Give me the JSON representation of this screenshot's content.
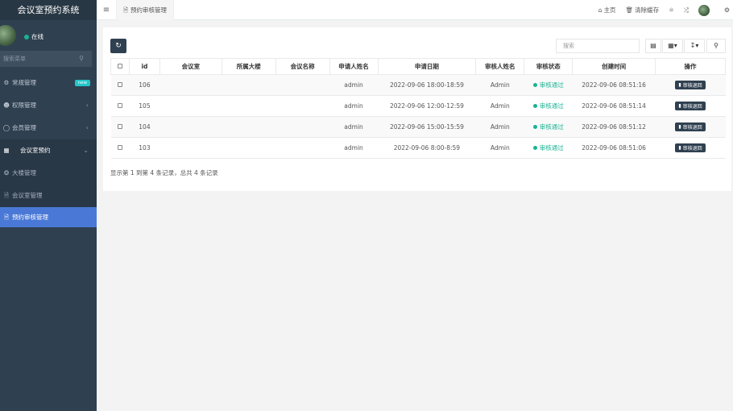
{
  "app": {
    "title": "会议室预约系统"
  },
  "user": {
    "status": "在线"
  },
  "sidebar": {
    "search_placeholder": "搜索菜单",
    "items": [
      {
        "label": "常规管理",
        "icon": "cogs-icon",
        "badge": "new"
      },
      {
        "label": "权限管理",
        "icon": "users-icon"
      },
      {
        "label": "会员管理",
        "icon": "user-icon"
      },
      {
        "label": "会议室预约",
        "icon": "list-icon",
        "open": true
      }
    ],
    "subitems": [
      {
        "label": "大楼管理",
        "icon": "circle-icon"
      },
      {
        "label": "会议室管理",
        "icon": "file-icon"
      },
      {
        "label": "预约审核管理",
        "icon": "file-icon",
        "active": true
      }
    ]
  },
  "topbar": {
    "tab_label": "预约审核管理",
    "home": "主页",
    "clear_cache": "清除缓存"
  },
  "toolbar": {
    "search_placeholder": "搜索"
  },
  "table": {
    "headers": [
      "id",
      "会议室",
      "所属大楼",
      "会议名称",
      "申请人姓名",
      "申请日期",
      "审核人姓名",
      "审核状态",
      "创建时间",
      "操作"
    ],
    "rows": [
      {
        "id": "106",
        "room": "",
        "building": "",
        "name": "",
        "applicant": "admin",
        "date": "2022-09-06 18:00-18:59",
        "reviewer": "Admin",
        "status": "审核通过",
        "created": "2022-09-06 08:51:16",
        "action": "审核退回"
      },
      {
        "id": "105",
        "room": "",
        "building": "",
        "name": "",
        "applicant": "admin",
        "date": "2022-09-06 12:00-12:59",
        "reviewer": "Admin",
        "status": "审核通过",
        "created": "2022-09-06 08:51:14",
        "action": "审核退回"
      },
      {
        "id": "104",
        "room": "",
        "building": "",
        "name": "",
        "applicant": "admin",
        "date": "2022-09-06 15:00-15:59",
        "reviewer": "Admin",
        "status": "审核通过",
        "created": "2022-09-06 08:51:12",
        "action": "审核退回"
      },
      {
        "id": "103",
        "room": "",
        "building": "",
        "name": "",
        "applicant": "admin",
        "date": "2022-09-06 8:00-8:59",
        "reviewer": "Admin",
        "status": "审核通过",
        "created": "2022-09-06 08:51:06",
        "action": "审核退回"
      }
    ],
    "summary": "显示第 1 到第 4 条记录，总共 4 条记录"
  },
  "colors": {
    "sidebar": "#2f4050",
    "active": "#4a78d6",
    "success": "#1ab394",
    "badge": "#23c6c8"
  }
}
